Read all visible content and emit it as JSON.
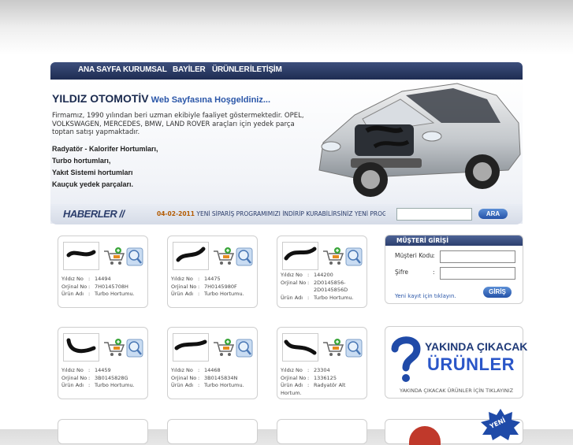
{
  "nav": {
    "items": [
      "ANA SAYFA",
      "KURUMSAL",
      "BAYİLER",
      "ÜRÜNLER",
      "İLETİŞİM"
    ]
  },
  "hero": {
    "brand": "YILDIZ OTOMOTİV",
    "welcome": "Web Sayfasına Hoşgeldiniz...",
    "intro": "Firmamız, 1990 yılından beri uzman ekibiyle faaliyet göstermektedir. OPEL, VOLKSWAGEN, MERCEDES, BMW, LAND ROVER araçları için yedek parça toptan satışı yapmaktadır.",
    "features": [
      "Radyatör - Kalorifer Hortumları,",
      "Turbo hortumları,",
      "Yakıt Sistemi hortumları",
      "Kauçuk yedek parçaları."
    ]
  },
  "news": {
    "heading": "HABERLER //",
    "date": "04-02-2011",
    "text": "YENİ SİPARİŞ PROGRAMIMIZI İNDİRİP KURABİLİRSİNİZ YENİ PROGRAM",
    "search_button": "ARA",
    "search_value": ""
  },
  "product_labels": {
    "code": "Yıldız No",
    "oem": "Orjinal No",
    "name": "Ürün Adı",
    "sep": ":"
  },
  "products": [
    {
      "code": "14494",
      "oem": "7H0145708H",
      "name": "Turbo Hortumu."
    },
    {
      "code": "14475",
      "oem": "7H0145980F",
      "name": "Turbo Hortumu."
    },
    {
      "code": "144200",
      "oem": "2D0145856-2D0145856D",
      "name": "Turbo Hortumu."
    },
    {
      "code": "14459",
      "oem": "3B0145828G",
      "name": "Turbo Hortumu."
    },
    {
      "code": "14468",
      "oem": "3B0145834N",
      "name": "Turbo Hortumu."
    },
    {
      "code": "23304",
      "oem": "1336125",
      "name": "Radyatör Alt Hortum."
    }
  ],
  "login": {
    "title": "MÜŞTERİ GİRİŞİ",
    "customer_code_label": "Müşteri Kodu",
    "password_label": "Şifre",
    "sep": ":",
    "customer_code_value": "",
    "password_value": "",
    "submit": "GİRİŞ",
    "register": "Yeni kayıt için tıklayın."
  },
  "upcoming": {
    "line1": "YAKINDA ÇIKACAK",
    "line2": "ÜRÜNLER",
    "link": "YAKINDA ÇIKACAK ÜRÜNLER İÇİN TIKLAYINIZ",
    "badge": "YENİ"
  },
  "colors": {
    "nav_bg": "#1e2c52",
    "accent_blue": "#2553a8",
    "brand_text": "#1a2a4e"
  }
}
